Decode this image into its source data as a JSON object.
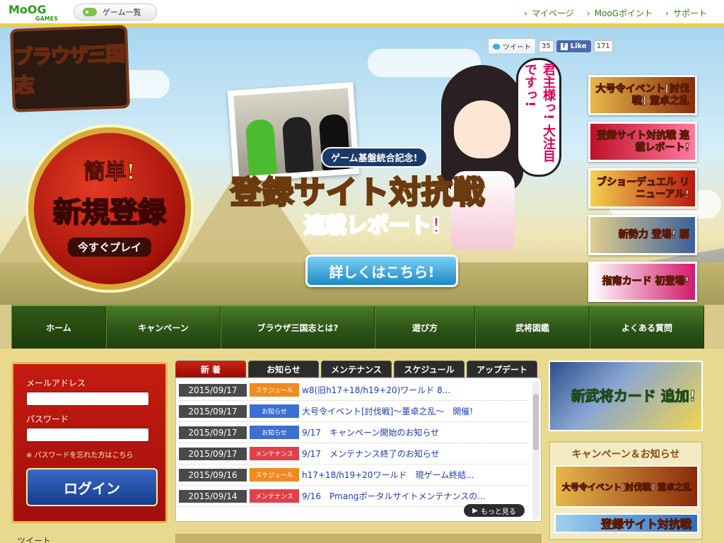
{
  "topbar": {
    "logo_text": "MoOG",
    "logo_sub": "GAMES",
    "game_list": "ゲーム一覧",
    "links": [
      "マイページ",
      "MooGポイント",
      "サポート"
    ]
  },
  "hero": {
    "title_logo": "ブラウザ三国志",
    "register_easy": "簡単!",
    "register_big": "新規登録",
    "register_now": "今すぐプレイ",
    "tweet": "ツイート",
    "tweet_count": "35",
    "like": "Like",
    "like_count": "171",
    "campaign_label": "ゲーム基盤統合記念!",
    "campaign_title": "登録サイト対抗戦",
    "campaign_sub": "連載レポート!",
    "detail_button": "詳しくはこちら!",
    "speech": "君主様っ! 大注目ですっ!",
    "banners": [
      {
        "text": "大号令イベント[討伐戦] 董卓之乱",
        "color": "#8a2a0c"
      },
      {
        "text": "登録サイト対抗戦 連載レポート!",
        "color": "#c0102a"
      },
      {
        "text": "ブショーデュエル リニューアル!",
        "color": "#b8180e"
      },
      {
        "text": "新勢力 登場! 覇",
        "color": "#3a5f9a"
      },
      {
        "text": "指南カード 初登場!",
        "color": "#d4186c"
      }
    ]
  },
  "nav": {
    "items": [
      "ホーム",
      "キャンペーン",
      "ブラウザ三国志とは?",
      "遊び方",
      "武将図鑑",
      "よくある質問"
    ]
  },
  "login": {
    "email_label": "メールアドレス",
    "password_label": "パスワード",
    "forgot": "※ パスワードを忘れた方はこちら",
    "button": "ログイン"
  },
  "news": {
    "tabs": [
      "新 着",
      "お知らせ",
      "メンテナンス",
      "スケジュール",
      "アップデート"
    ],
    "rows": [
      {
        "date": "2015/09/17",
        "category": "スケジュール",
        "cat_color": "#f08a1c",
        "title": "w8(旧h17+18/h19+20)ワールド 8..."
      },
      {
        "date": "2015/09/17",
        "category": "お知らせ",
        "cat_color": "#3c6fd0",
        "title": "大号令イベント[討伐戦]〜董卓之乱〜　開催!"
      },
      {
        "date": "2015/09/17",
        "category": "お知らせ",
        "cat_color": "#3c6fd0",
        "title": "9/17　キャンペーン開始のお知らせ"
      },
      {
        "date": "2015/09/17",
        "category": "メンテナンス",
        "cat_color": "#e04048",
        "title": "9/17　メンテナンス終了のお知らせ"
      },
      {
        "date": "2015/09/16",
        "category": "スケジュール",
        "cat_color": "#f08a1c",
        "title": "h17+18/h19+20ワールド　現ゲーム終結..."
      },
      {
        "date": "2015/09/14",
        "category": "メンテナンス",
        "cat_color": "#e04048",
        "title": "9/16　Pmangポータルサイトメンテナンスの..."
      }
    ],
    "more": "もっと見る"
  },
  "right": {
    "general_card": "新武将カード 追加!",
    "campaign_head": "キャンペーン＆お知らせ",
    "campaign_banners": [
      {
        "text": "大号令イベント[討伐戦] 董卓之乱",
        "color": "#8a2a0c"
      },
      {
        "text": "登録サイト対抗戦",
        "color": "#2a6fc0"
      }
    ]
  },
  "bottom": {
    "tweet_label": "ツイート"
  }
}
